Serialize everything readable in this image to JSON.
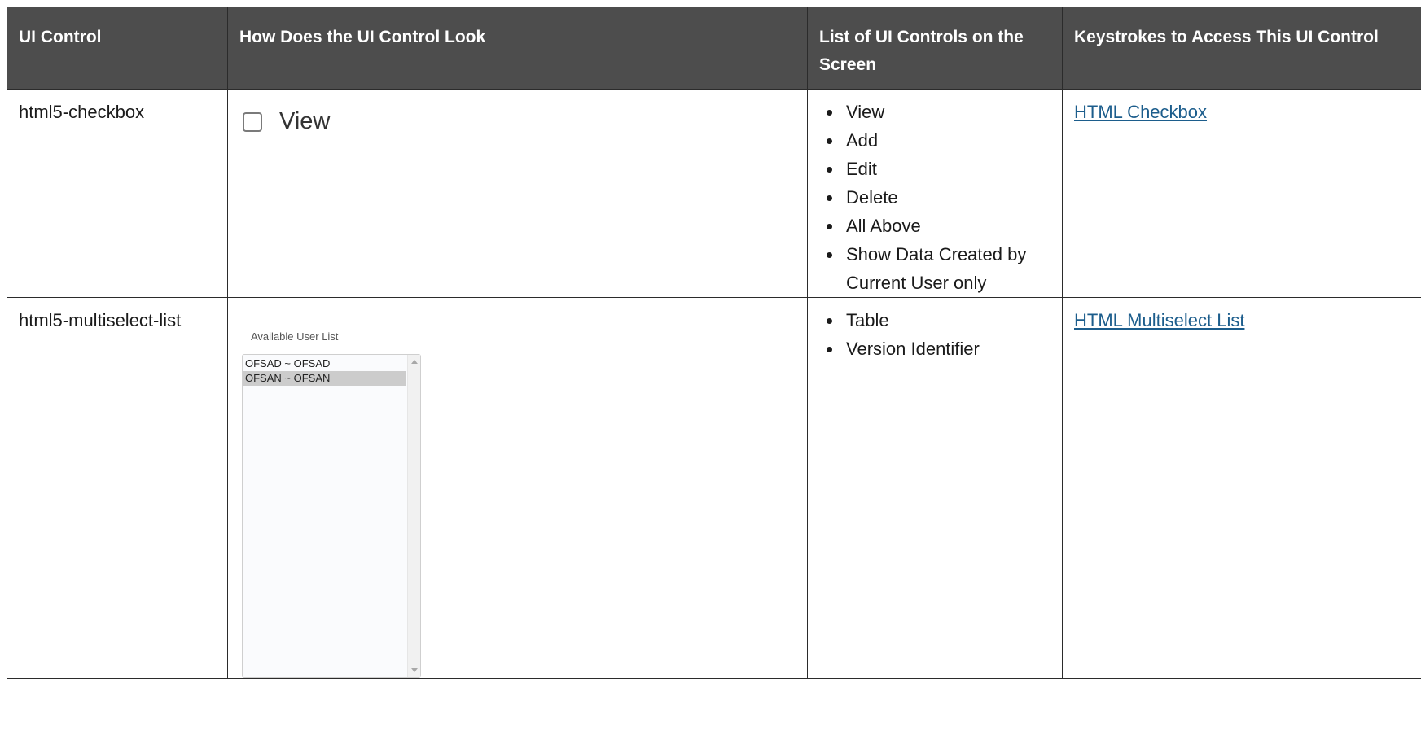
{
  "table": {
    "headers": [
      "UI Control",
      "How Does the UI Control Look",
      "List of UI Controls on the Screen",
      "Keystrokes to Access This UI Control"
    ],
    "rows": [
      {
        "control": "html5-checkbox",
        "preview": {
          "checkbox_label": "View",
          "checked": false
        },
        "controls": [
          "View",
          "Add",
          "Edit",
          "Delete",
          "All Above",
          "Show Data Created by Current User only"
        ],
        "link": "HTML Checkbox"
      },
      {
        "control": "html5-multiselect-list",
        "preview": {
          "list_title": "Available User List",
          "options": [
            "OFSAD ~ OFSAD",
            "OFSAN ~ OFSAN"
          ],
          "selected_option": "OFSAN ~ OFSAN"
        },
        "controls": [
          "Table",
          "Version Identifier"
        ],
        "link": "HTML Multiselect List"
      }
    ]
  },
  "colors": {
    "header_bg": "#4d4d4d",
    "header_text": "#ffffff",
    "link": "#1c5d8c",
    "selected_option_bg": "#cccccc"
  }
}
